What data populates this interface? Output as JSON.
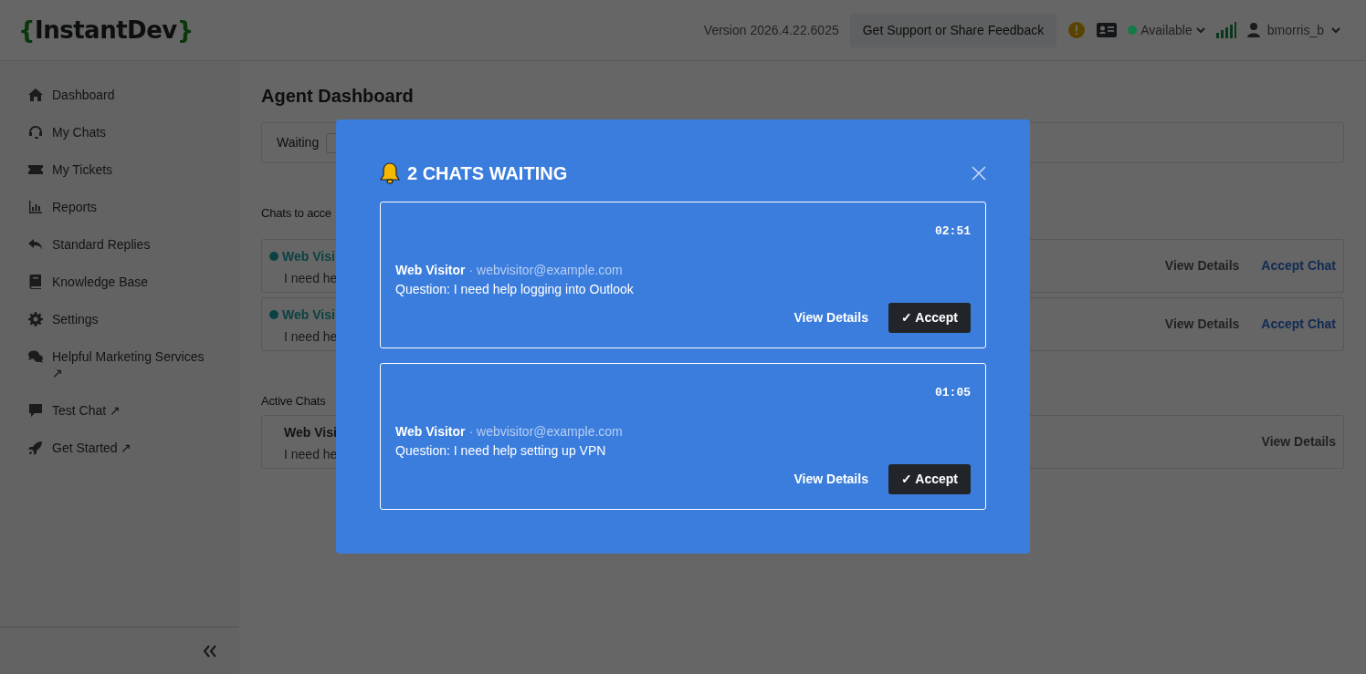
{
  "header": {
    "logo": {
      "open": "{",
      "name": "InstantDev",
      "close": "}"
    },
    "version": "Version 2026.4.22.6025",
    "support_button": "Get Support or Share Feedback",
    "status": {
      "label": "Available",
      "color": "#137a4a"
    },
    "user": "bmorris_b"
  },
  "sidebar": {
    "items": [
      {
        "label": "Dashboard",
        "kind": "home"
      },
      {
        "label": "My Chats",
        "kind": "headset"
      },
      {
        "label": "My Tickets",
        "kind": "ticket"
      },
      {
        "label": "Reports",
        "kind": "chart"
      },
      {
        "label": "Standard Replies",
        "kind": "reply"
      },
      {
        "label": "Knowledge Base",
        "kind": "book"
      },
      {
        "label": "Settings",
        "kind": "gear"
      },
      {
        "label": "Helpful Marketing Services ↗",
        "kind": "comments"
      },
      {
        "label": "Test Chat ↗",
        "kind": "comment"
      },
      {
        "label": "Get Started ↗",
        "kind": "rocket"
      }
    ]
  },
  "main": {
    "title": "Agent Dashboard",
    "waiting_label": "Waiting",
    "sections": [
      {
        "heading": "Chats to acce",
        "chats": [
          {
            "name": "Web Visi",
            "message": "I need he",
            "online": true,
            "actions": [
              "View Details",
              "Accept Chat"
            ]
          },
          {
            "name": "Web Visi",
            "message": "I need he",
            "online": true,
            "actions": [
              "View Details",
              "Accept Chat"
            ]
          }
        ]
      },
      {
        "heading": "Active Chats",
        "chats": [
          {
            "name": "Web Visi",
            "message": "I need he",
            "online": false,
            "actions": [
              "View Details"
            ]
          }
        ]
      }
    ]
  },
  "modal": {
    "title": "2 CHATS WAITING",
    "chats": [
      {
        "timer": "02:51",
        "name": "Web Visitor",
        "email": "· webvisitor@example.com",
        "question": "Question: I need help logging into Outlook",
        "view_button": "View Details",
        "accept_button": "✓ Accept"
      },
      {
        "timer": "01:05",
        "name": "Web Visitor",
        "email": "· webvisitor@example.com",
        "question": "Question: I need help setting up VPN",
        "view_button": "View Details",
        "accept_button": "✓ Accept"
      }
    ]
  }
}
